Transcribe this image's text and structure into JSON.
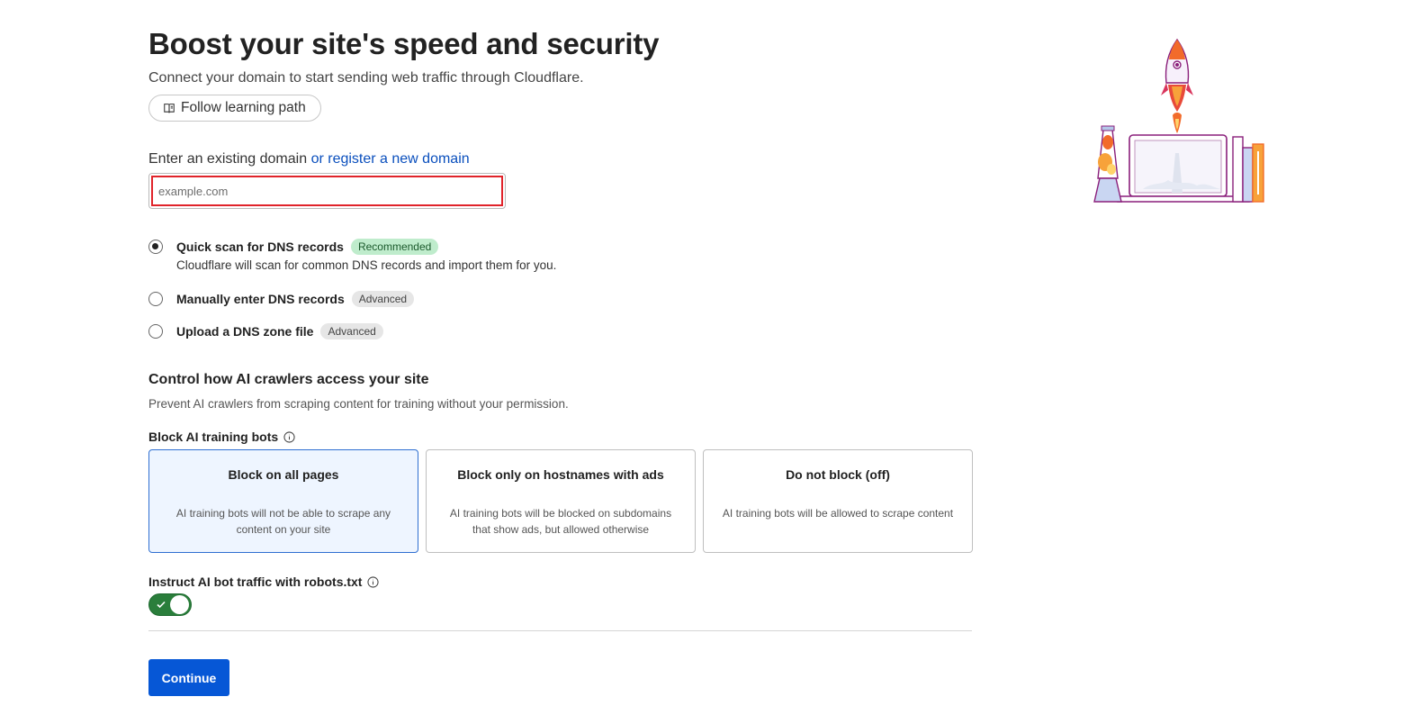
{
  "header": {
    "title": "Boost your site's speed and security",
    "subtitle": "Connect your domain to start sending web traffic through Cloudflare.",
    "learning_path_label": "Follow learning path"
  },
  "domain": {
    "label": "Enter an existing domain",
    "register_link": "or register a new domain",
    "placeholder": "example.com",
    "value": ""
  },
  "dns_options": [
    {
      "label": "Quick scan for DNS records",
      "badge": "Recommended",
      "checked": true,
      "description": "Cloudflare will scan for common DNS records and import them for you."
    },
    {
      "label": "Manually enter DNS records",
      "badge": "Advanced",
      "checked": false
    },
    {
      "label": "Upload a DNS zone file",
      "badge": "Advanced",
      "checked": false
    }
  ],
  "ai": {
    "heading": "Control how AI crawlers access your site",
    "subheading": "Prevent AI crawlers from scraping content for training without your permission.",
    "block_label": "Block AI training bots",
    "cards": [
      {
        "title": "Block on all pages",
        "description": "AI training bots will not be able to scrape any content on your site",
        "selected": true
      },
      {
        "title": "Block only on hostnames with ads",
        "description": "AI training bots will be blocked on subdomains that show ads, but allowed otherwise",
        "selected": false
      },
      {
        "title": "Do not block (off)",
        "description": "AI training bots will be allowed to scrape content",
        "selected": false
      }
    ],
    "robots_label": "Instruct AI bot traffic with robots.txt",
    "robots_enabled": true
  },
  "actions": {
    "continue_label": "Continue"
  },
  "colors": {
    "primary": "#0657d6",
    "link": "#0a4fbd",
    "toggle_on": "#2a7e3b",
    "error_border": "#e0232a"
  }
}
